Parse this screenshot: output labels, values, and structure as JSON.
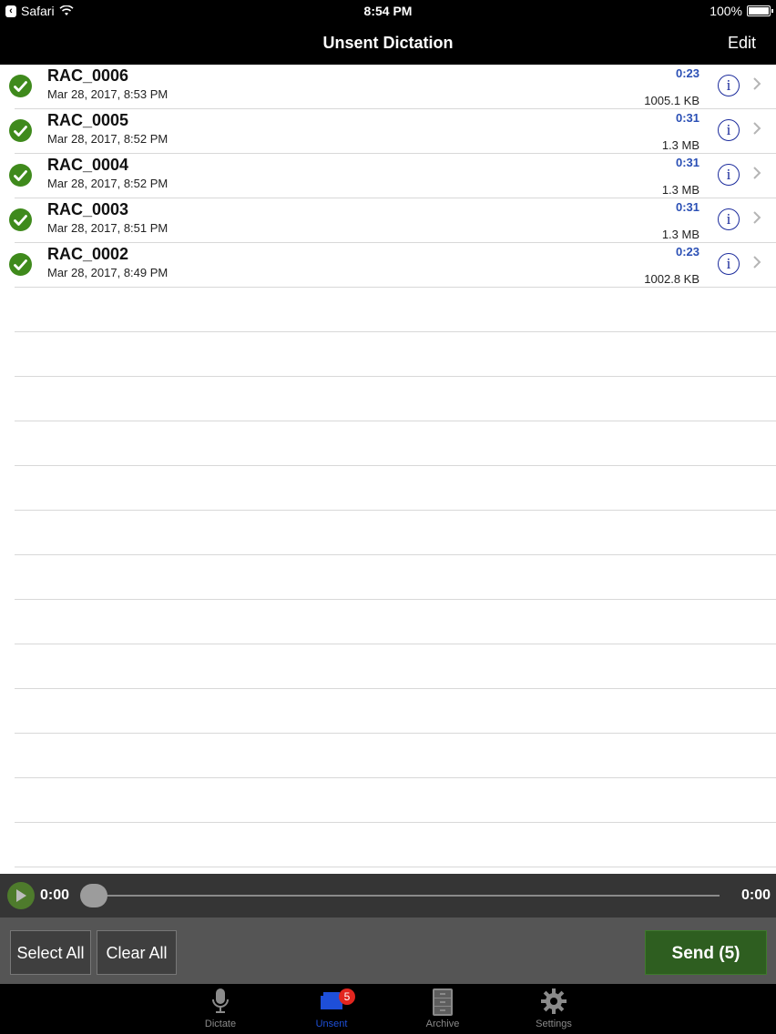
{
  "status_bar": {
    "back_app": "Safari",
    "time": "8:54 PM",
    "battery": "100%"
  },
  "nav": {
    "title": "Unsent Dictation",
    "edit_label": "Edit"
  },
  "recordings": [
    {
      "name": "RAC_0006",
      "date": "Mar 28, 2017, 8:53 PM",
      "duration": "0:23",
      "size": "1005.1 KB"
    },
    {
      "name": "RAC_0005",
      "date": "Mar 28, 2017, 8:52 PM",
      "duration": "0:31",
      "size": "1.3 MB"
    },
    {
      "name": "RAC_0004",
      "date": "Mar 28, 2017, 8:52 PM",
      "duration": "0:31",
      "size": "1.3 MB"
    },
    {
      "name": "RAC_0003",
      "date": "Mar 28, 2017, 8:51 PM",
      "duration": "0:31",
      "size": "1.3 MB"
    },
    {
      "name": "RAC_0002",
      "date": "Mar 28, 2017, 8:49 PM",
      "duration": "0:23",
      "size": "1002.8 KB"
    }
  ],
  "player": {
    "current_time": "0:00",
    "total_time": "0:00",
    "progress": 0
  },
  "actions": {
    "select_all": "Select All",
    "clear_all": "Clear All",
    "send": "Send (5)"
  },
  "tabs": [
    {
      "label": "Dictate",
      "icon": "microphone-icon",
      "active": false
    },
    {
      "label": "Unsent",
      "icon": "tray-icon",
      "active": true,
      "badge": "5"
    },
    {
      "label": "Archive",
      "icon": "file-cabinet-icon",
      "active": false
    },
    {
      "label": "Settings",
      "icon": "gear-icon",
      "active": false
    }
  ],
  "colors": {
    "accent": "#1e4fd8",
    "check": "#3f8a1c",
    "send": "#2e5e20",
    "duration": "#2a4fb5",
    "info": "#1b2b9c",
    "badge": "#e2261f"
  }
}
